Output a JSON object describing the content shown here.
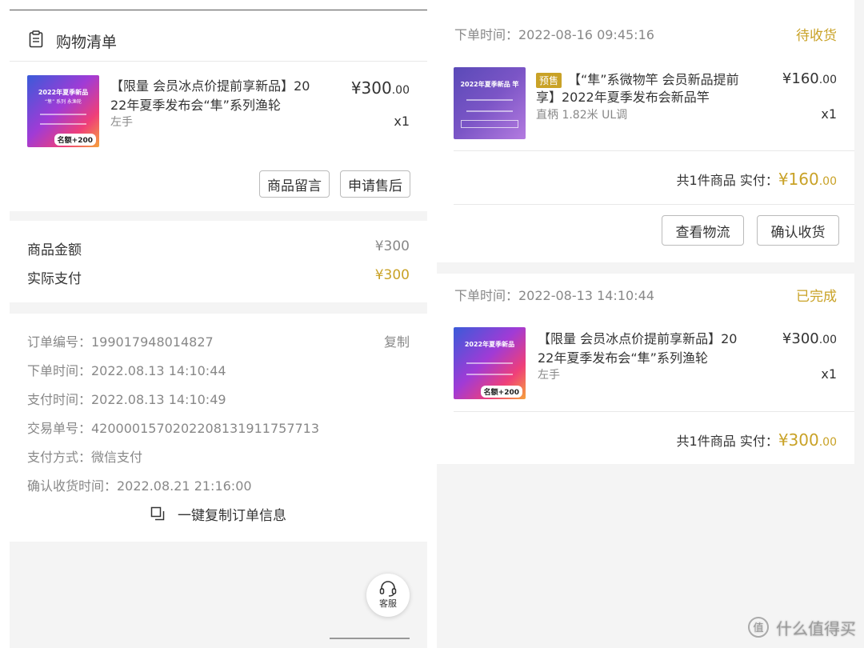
{
  "left": {
    "section_title": "购物清单",
    "item": {
      "name_line1": "【限量 会员冰点价提前享新品】20",
      "name_line2": "22年夏季发布会“隼”系列渔轮",
      "variant": "左手",
      "price_int": "¥300",
      "price_dec": ".00",
      "qty": "x1",
      "thumb_title": "2022年夏季新品",
      "thumb_sub": "“隼” 系列 永渔轮",
      "thumb_badge": "名额+200"
    },
    "buttons": {
      "message": "商品留言",
      "aftersale": "申请售后"
    },
    "amounts": {
      "goods_label": "商品金额",
      "goods_value": "¥300",
      "paid_label": "实际支付",
      "paid_value": "¥300"
    },
    "details": {
      "order_no": "订单编号：199017948014827",
      "copy": "复制",
      "order_time": "下单时间：2022.08.13 14:10:44",
      "pay_time": "支付时间：2022.08.13 14:10:49",
      "trade_no": "交易单号：4200001570202208131911757713",
      "pay_method": "支付方式：微信支付",
      "confirm_time": "确认收货时间：2022.08.21 21:16:00",
      "copy_all": "一键复制订单信息"
    },
    "customer_service": "客服"
  },
  "right": {
    "orders": [
      {
        "time": "下单时间：2022-08-16 09:45:16",
        "status": "待收货",
        "tag": "预售",
        "name_line1": "【“隼”系微物竿 会员新品提前",
        "name_line2": "享】2022年夏季发布会新品竿",
        "variant": "直柄 1.82米 UL调",
        "price_int": "¥160",
        "price_dec": ".00",
        "qty": "x1",
        "summary": "共1件商品  实付：",
        "total_int": "¥160",
        "total_dec": ".00",
        "thumb_title": "2022年夏季新品 竿",
        "btn_logistics": "查看物流",
        "btn_confirm": "确认收货"
      },
      {
        "time": "下单时间：2022-08-13 14:10:44",
        "status": "已完成",
        "name_line1": "【限量 会员冰点价提前享新品】20",
        "name_line2": "22年夏季发布会“隼”系列渔轮",
        "variant": "左手",
        "price_int": "¥300",
        "price_dec": ".00",
        "qty": "x1",
        "summary": "共1件商品  实付：",
        "total_int": "¥300",
        "total_dec": ".00",
        "thumb_title": "2022年夏季新品",
        "thumb_badge": "名额+200"
      }
    ]
  },
  "watermark": "什么值得买",
  "colors": {
    "gold": "#c9a227",
    "gray_bg": "#f4f4f4",
    "text": "#333333"
  }
}
